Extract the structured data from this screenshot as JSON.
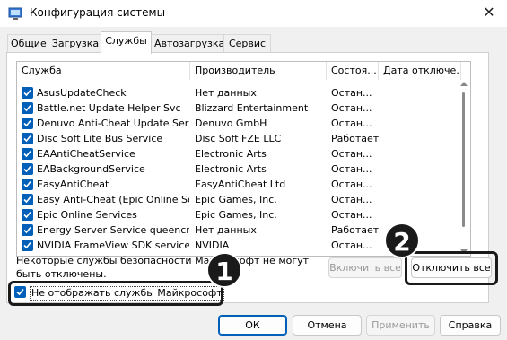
{
  "window": {
    "title": "Конфигурация системы",
    "close_glyph": "✕"
  },
  "tabs": [
    "Общие",
    "Загрузка",
    "Службы",
    "Автозагрузка",
    "Сервис"
  ],
  "list": {
    "columns": [
      "Служба",
      "Производитель",
      "Состоя...",
      "Дата отключе..."
    ],
    "rows": [
      [
        "AsusUpdateCheck",
        "Нет данных",
        "Остан...",
        ""
      ],
      [
        "Battle.net Update Helper Svc",
        "Blizzard Entertainment",
        "Остан...",
        ""
      ],
      [
        "Denuvo Anti-Cheat Update Service",
        "Denuvo GmbH",
        "Остан...",
        ""
      ],
      [
        "Disc Soft Lite Bus Service",
        "Disc Soft FZE LLC",
        "Работает",
        ""
      ],
      [
        "EAAntiCheatService",
        "Electronic Arts",
        "Остан...",
        ""
      ],
      [
        "EABackgroundService",
        "Electronic Arts",
        "Остан...",
        ""
      ],
      [
        "EasyAntiCheat",
        "EasyAntiCheat Ltd",
        "Остан...",
        ""
      ],
      [
        "Easy Anti-Cheat (Epic Online Ser...",
        "Epic Games, Inc.",
        "Остан...",
        ""
      ],
      [
        "Epic Online Services",
        "Epic Games, Inc.",
        "Остан...",
        ""
      ],
      [
        "Energy Server Service queencreek",
        "Нет данных",
        "Работает",
        ""
      ],
      [
        "NVIDIA FrameView SDK service",
        "NVIDIA",
        "Остан...",
        ""
      ]
    ]
  },
  "note": "Некоторые службы безопасности Майкрософт не могут быть отключены.",
  "buttons": {
    "enable_all": "Включить все",
    "disable_all": "Отключить все",
    "ok": "ОК",
    "cancel": "Отмена",
    "apply": "Применить",
    "help": "Справка"
  },
  "hide_ms_label": "Не отображать службы Майкрософт",
  "annotations": {
    "badge1": "1",
    "badge2": "2"
  },
  "colors": {
    "accent": "#005fb8",
    "highlight": "#1a1a1a"
  }
}
